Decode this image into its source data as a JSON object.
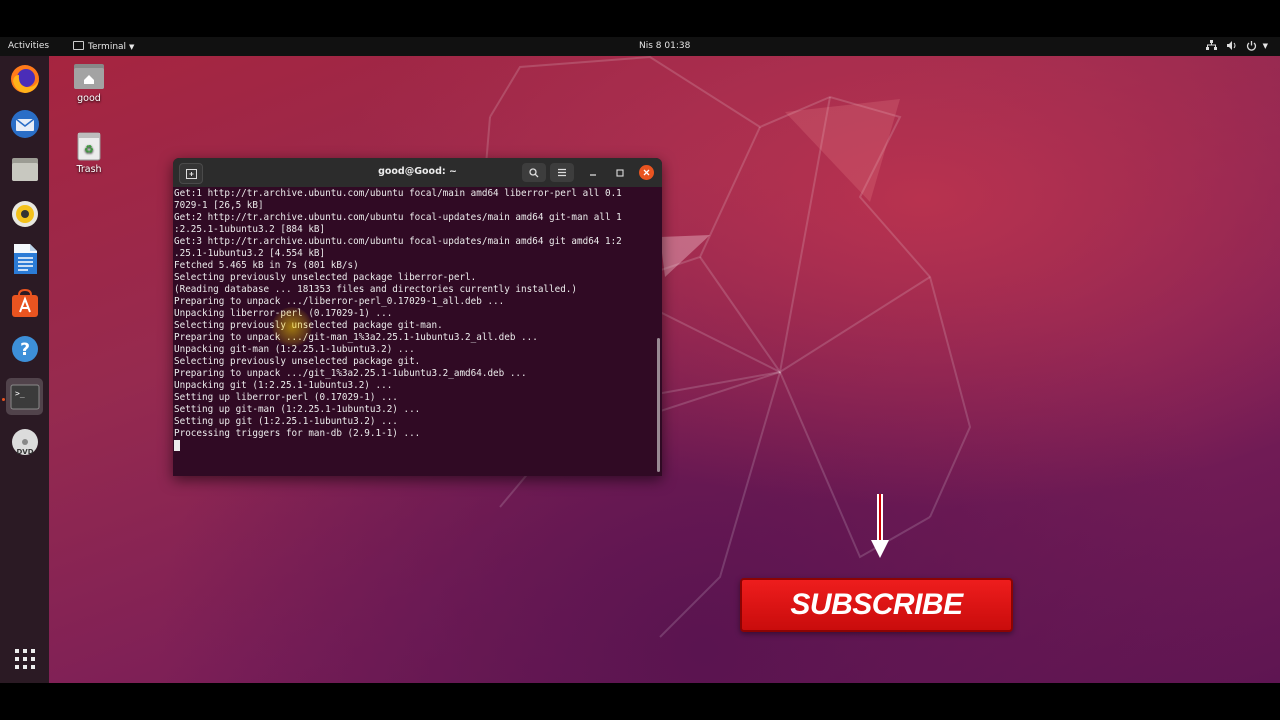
{
  "topbar": {
    "activities": "Activities",
    "app_menu": "Terminal",
    "clock": "Nis 8  01:38"
  },
  "dock": {
    "items": [
      "firefox-icon",
      "thunderbird-icon",
      "files-icon",
      "rhythmbox-icon",
      "libreoffice-writer-icon",
      "software-icon",
      "help-icon",
      "terminal-icon",
      "dvd-icon"
    ],
    "apps_grid": "show-applications-icon"
  },
  "desktop": {
    "home_label": "good",
    "trash_label": "Trash"
  },
  "terminal": {
    "title": "good@Good: ~",
    "lines": [
      "Get:1 http://tr.archive.ubuntu.com/ubuntu focal/main amd64 liberror-perl all 0.1",
      "7029-1 [26,5 kB]",
      "Get:2 http://tr.archive.ubuntu.com/ubuntu focal-updates/main amd64 git-man all 1",
      ":2.25.1-1ubuntu3.2 [884 kB]",
      "Get:3 http://tr.archive.ubuntu.com/ubuntu focal-updates/main amd64 git amd64 1:2",
      ".25.1-1ubuntu3.2 [4.554 kB]",
      "Fetched 5.465 kB in 7s (801 kB/s)",
      "Selecting previously unselected package liberror-perl.",
      "(Reading database ... 181353 files and directories currently installed.)",
      "Preparing to unpack .../liberror-perl_0.17029-1_all.deb ...",
      "Unpacking liberror-perl (0.17029-1) ...",
      "Selecting previously unselected package git-man.",
      "Preparing to unpack .../git-man_1%3a2.25.1-1ubuntu3.2_all.deb ...",
      "Unpacking git-man (1:2.25.1-1ubuntu3.2) ...",
      "Selecting previously unselected package git.",
      "Preparing to unpack .../git_1%3a2.25.1-1ubuntu3.2_amd64.deb ...",
      "Unpacking git (1:2.25.1-1ubuntu3.2) ...",
      "Setting up liberror-perl (0.17029-1) ...",
      "Setting up git-man (1:2.25.1-1ubuntu3.2) ...",
      "Setting up git (1:2.25.1-1ubuntu3.2) ...",
      "Processing triggers for man-db (2.9.1-1) ..."
    ]
  },
  "overlay": {
    "subscribe_label": "SUBSCRIBE"
  },
  "colors": {
    "terminal_bg": "#300a24",
    "accent": "#e95420",
    "subscribe_red": "#e11616"
  }
}
